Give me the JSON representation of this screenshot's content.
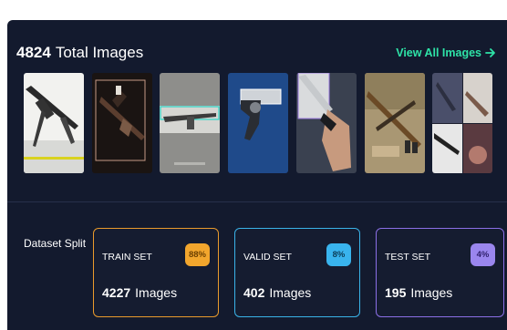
{
  "header": {
    "count": "4824",
    "label": "Total Images",
    "view_all": "View All Images",
    "view_all_icon": "arrow-right-icon"
  },
  "thumbnails": [
    {
      "name": "thumb-rifle-white"
    },
    {
      "name": "thumb-rifle-dark"
    },
    {
      "name": "thumb-rifle-gray"
    },
    {
      "name": "thumb-revolver-blue"
    },
    {
      "name": "thumb-knife-hand"
    },
    {
      "name": "thumb-rifle-floor"
    },
    {
      "name": "thumb-collage"
    }
  ],
  "split": {
    "label": "Dataset Split",
    "cards": [
      {
        "title": "TRAIN SET",
        "badge": "88%",
        "count": "4227",
        "unit": "Images",
        "accent": "#e99a2c",
        "badge_bg": "#f2a62d"
      },
      {
        "title": "VALID SET",
        "badge": "8%",
        "count": "402",
        "unit": "Images",
        "accent": "#3ab3e8",
        "badge_bg": "#39b4ee"
      },
      {
        "title": "TEST SET",
        "badge": "4%",
        "count": "195",
        "unit": "Images",
        "accent": "#8b6fe6",
        "badge_bg": "#9a86ee"
      }
    ]
  },
  "colors": {
    "panel_bg": "#131a2e",
    "link": "#2ee3a7"
  }
}
